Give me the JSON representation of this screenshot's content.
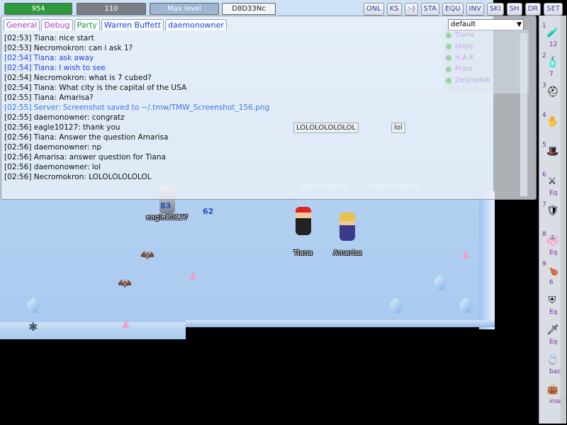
{
  "status": {
    "hp": "954",
    "mp": "110",
    "xp": "Max level",
    "money": "D8D33Nc"
  },
  "top_buttons": [
    "ONL",
    "KS",
    ":-)",
    "STA",
    "EQU",
    "INV",
    "SKI",
    "SH",
    "DR",
    "SET"
  ],
  "chat": {
    "tabs": [
      "General",
      "Debug",
      "Party",
      "Warren Buffett",
      "daemonowner"
    ],
    "channel_select": "default",
    "lines": [
      {
        "text": "[02:53] Tiana: nice start",
        "color": "black"
      },
      {
        "text": "[02:53] Necromokron: can i ask 1?",
        "color": "black"
      },
      {
        "text": "[02:54] Tiana: ask away",
        "color": "blue"
      },
      {
        "text": "[02:54] Tiana: I wish to see",
        "color": "blue"
      },
      {
        "text": "[02:54] Necromokron: what is 7 cubed?",
        "color": "black"
      },
      {
        "text": "[02:54] Tiana: What city is the capital of the USA",
        "color": "black"
      },
      {
        "text": "[02:55] Tiana: Amarisa?",
        "color": "black"
      },
      {
        "text": "[02:55] Server: Screenshot saved to ~/.tmw/TMW_Screenshot_156.png",
        "color": "server"
      },
      {
        "text": "[02:55] daemonowner: congratz",
        "color": "black"
      },
      {
        "text": "[02:56] eagle10127: thank you",
        "color": "black"
      },
      {
        "text": "[02:56] Tiana: Answer the question Amarisa",
        "color": "black"
      },
      {
        "text": "[02:56] daemonowner: np",
        "color": "black"
      },
      {
        "text": "[02:56] Amarisa: answer question for Tiana",
        "color": "black"
      },
      {
        "text": "[02:56] daemonowner: lol",
        "color": "black"
      },
      {
        "text": "[02:56] Necromokron: LOLOLOLOLOLOL",
        "color": "black"
      }
    ]
  },
  "online_users": [
    "Tiana",
    "skipy",
    "H.A.K",
    "Prsm",
    "ZeShadok"
  ],
  "world": {
    "players": {
      "tiana": "Tiana",
      "amarisa": "Amarisa",
      "eagle": "eagle10127",
      "necromokron": "Necromokron",
      "daemonowner": "daemonowner"
    },
    "speech_1": "LOLOLOLOLOLOL",
    "speech_2": "lol",
    "damage_1": "83",
    "damage_2": "62"
  },
  "inventory": [
    {
      "count": "1",
      "sub": "12",
      "icon": "potion-icon"
    },
    {
      "count": "2",
      "sub": "7",
      "icon": "potion-icon"
    },
    {
      "count": "3",
      "sub": "",
      "icon": "helmet-icon"
    },
    {
      "count": "4",
      "sub": "",
      "icon": "gloves-icon"
    },
    {
      "count": "5",
      "sub": "",
      "icon": "hat-icon"
    },
    {
      "count": "6",
      "sub": "Eq",
      "icon": "weapon-icon"
    },
    {
      "count": "7",
      "sub": "",
      "icon": "armor-icon"
    },
    {
      "count": "8",
      "sub": "Eq",
      "icon": "robe-icon"
    },
    {
      "count": "9",
      "sub": "6",
      "icon": "drumstick-icon"
    },
    {
      "count": "",
      "sub": "Eq",
      "icon": "shield-icon"
    },
    {
      "count": "",
      "sub": "Eq",
      "icon": "sword-icon"
    },
    {
      "count": "",
      "sub": "bacl",
      "icon": "ring-icon"
    },
    {
      "count": "",
      "sub": "inse",
      "icon": "bag-icon"
    }
  ]
}
